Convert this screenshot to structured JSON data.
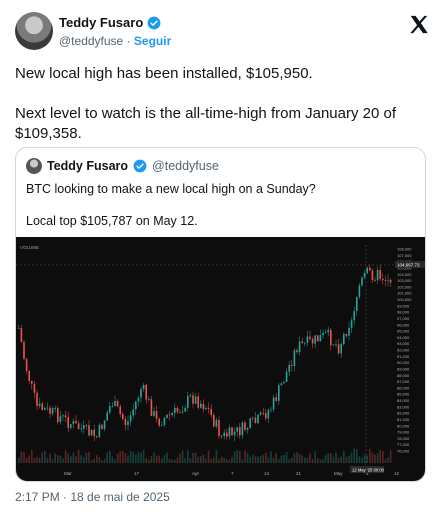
{
  "author": {
    "name": "Teddy Fusaro",
    "handle": "@teddyfuse",
    "separator": "·",
    "follow_label": "Seguir"
  },
  "tweet": {
    "text": "New local high has been installed, $105,950.\n\nNext level to watch is the all-time-high from January 20 of $109,358."
  },
  "quoted_tweet": {
    "name": "Teddy Fusaro",
    "handle": "@teddyfuse",
    "text": "BTC looking to make a new local high on a Sunday?\n\nLocal top $105,787 on May 12."
  },
  "chart": {
    "price_label": "104,667.73",
    "volume_label": "VOLUME",
    "date_tag": "12 May '25  00:00",
    "x_labels": [
      "Mar",
      "17",
      "Apr",
      "7",
      "14",
      "21",
      "May",
      "5",
      "12"
    ],
    "y_labels": [
      "108,000",
      "107,000",
      "106,000",
      "105,000",
      "104,000",
      "103,000",
      "102,000",
      "101,000",
      "100,000",
      "99,000",
      "98,000",
      "97,000",
      "96,000",
      "95,000",
      "94,000",
      "93,000",
      "92,000",
      "91,000",
      "90,000",
      "89,000",
      "88,000",
      "87,000",
      "86,000",
      "85,000",
      "84,000",
      "83,000",
      "82,000",
      "81,000",
      "80,000",
      "79,000",
      "78,000",
      "77,000",
      "76,000"
    ],
    "colors": {
      "up": "#26a69a",
      "down": "#ef5350",
      "bg": "#0d0d0d"
    }
  },
  "timestamp": "2:17 PM · 18 de mai de 2025"
}
